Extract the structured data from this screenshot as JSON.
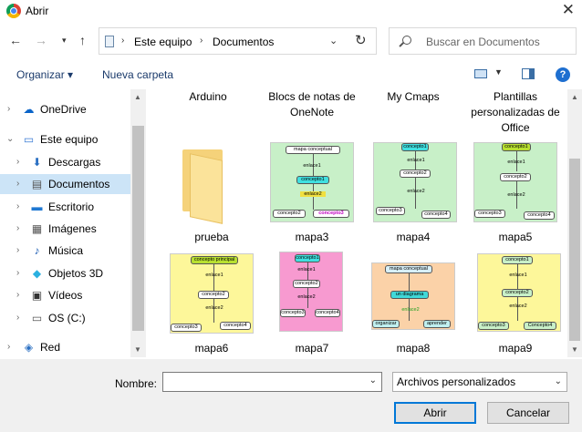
{
  "window": {
    "title": "Abrir"
  },
  "address": {
    "crumbs": [
      "Este equipo",
      "Documentos"
    ],
    "search_placeholder": "Buscar en Documentos"
  },
  "toolbar": {
    "organize": "Organizar",
    "new_folder": "Nueva carpeta"
  },
  "nav": {
    "items": [
      {
        "label": "OneDrive"
      },
      {
        "label": "Este equipo"
      },
      {
        "label": "Descargas"
      },
      {
        "label": "Documentos"
      },
      {
        "label": "Escritorio"
      },
      {
        "label": "Imágenes"
      },
      {
        "label": "Música"
      },
      {
        "label": "Objetos 3D"
      },
      {
        "label": "Vídeos"
      },
      {
        "label": "OS (C:)"
      },
      {
        "label": "Red"
      }
    ]
  },
  "items": {
    "top_row": [
      "Arduino",
      "Blocs de notas de OneNote",
      "My Cmaps",
      "Plantillas personalizadas de Office"
    ],
    "row1": [
      "prueba",
      "mapa3",
      "mapa4",
      "mapa5"
    ],
    "row2": [
      "mapa6",
      "mapa7",
      "mapa8",
      "mapa9"
    ]
  },
  "maps": {
    "mapa3": {
      "n1": "mapa conceptual",
      "l1": "enlace1",
      "n2": "concepto1",
      "l2": "enlace2",
      "n3": "concepto2",
      "n4": "concepto3"
    },
    "mapa4": {
      "n1": "concepto1",
      "l1": "enlace1",
      "n2": "concepto2",
      "l2": "enlace2",
      "n3": "concepto3",
      "n4": "concepto4"
    },
    "mapa5": {
      "n1": "concepto1",
      "l1": "enlace1",
      "n2": "concepto2",
      "l2": "enlace2",
      "n3": "concepto3",
      "n4": "concepto4"
    },
    "mapa6": {
      "n1": "concepto principal",
      "l1": "enlace1",
      "n2": "concepto2",
      "l2": "enlace2",
      "n3": "concepto3",
      "n4": "concepto4"
    },
    "mapa7": {
      "n1": "concepto1",
      "l1": "enlace1",
      "n2": "concepto2",
      "l2": "enlace2",
      "n3": "concepto3",
      "n4": "concepto4"
    },
    "mapa8": {
      "n1": "mapa conceptual",
      "l1": "enlace1",
      "n2": "un diagrama",
      "l2": "enlace2",
      "n3": "organizar",
      "n4": "aprender"
    },
    "mapa9": {
      "n1": "concepto1",
      "l1": "enlace1",
      "n2": "concepto2",
      "l2": "enlace2",
      "n3": "concepto3",
      "n4": "Concepto4"
    }
  },
  "bottom": {
    "name_label": "Nombre:",
    "name_value": "",
    "filter": "Archivos personalizados",
    "open": "Abrir",
    "cancel": "Cancelar"
  },
  "colors": {
    "mapa3_bg": "#c8f0c8",
    "mapa4_bg": "#c8f0c8",
    "mapa5_bg": "#c8f0c8",
    "mapa6_bg": "#fdf79a",
    "mapa7_bg": "#f79ad0",
    "mapa8_bg": "#fbd2a8",
    "mapa9_bg": "#fdf79a",
    "selection": "#cce4f7",
    "accent": "#0078d7"
  }
}
